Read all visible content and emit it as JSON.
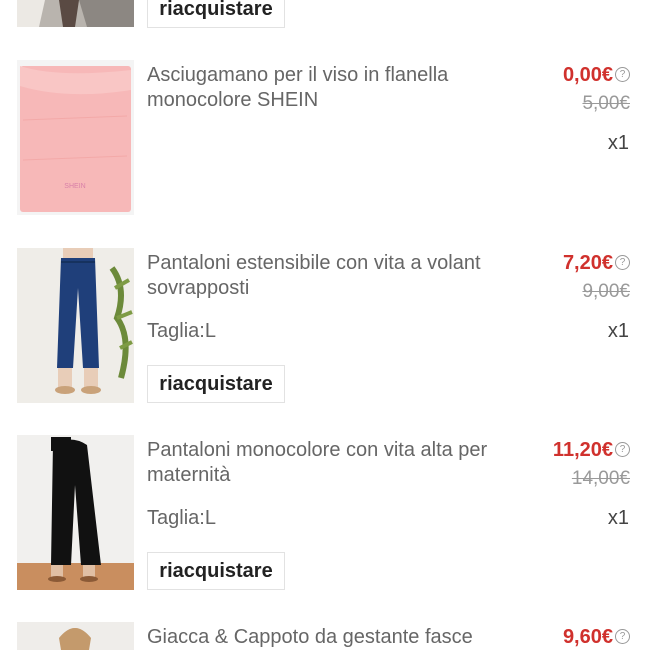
{
  "colors": {
    "price": "#d0312d",
    "old_price": "#999999",
    "title": "#666666"
  },
  "help_icon": "question-circle-icon",
  "items": [
    {
      "title": "",
      "button": "riacquistare"
    },
    {
      "title": "Asciugamano per il viso in flanella monocolore SHEIN",
      "price": "0,00€",
      "old_price": "5,00€",
      "qty": "x1",
      "thumb_text": "SHEIN"
    },
    {
      "title": "Pantaloni estensibile con vita a volant sovrapposti",
      "price": "7,20€",
      "old_price": "9,00€",
      "size": "Taglia:L",
      "qty": "x1",
      "button": "riacquistare"
    },
    {
      "title": "Pantaloni monocolore con vita alta per maternità",
      "price": "11,20€",
      "old_price": "14,00€",
      "size": "Taglia:L",
      "qty": "x1",
      "button": "riacquistare"
    },
    {
      "title": "Giacca & Cappoto da gestante fasce",
      "price": "9,60€"
    }
  ]
}
